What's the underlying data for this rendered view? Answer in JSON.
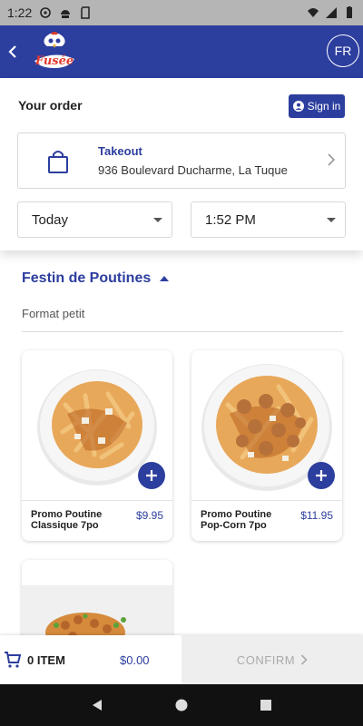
{
  "statusbar": {
    "time": "1:22"
  },
  "header": {
    "brand_logo_text": "Fusée",
    "lang_label": "FR"
  },
  "order": {
    "title": "Your order",
    "signin_label": "Sign in",
    "mode_label": "Takeout",
    "address": "936 Boulevard Ducharme, La Tuque",
    "day_value": "Today",
    "time_value": "1:52 PM"
  },
  "category": {
    "name": "Festin de Poutines",
    "subtitle": "Format petit"
  },
  "products": [
    {
      "name": "Promo Poutine Classique 7po",
      "price": "$9.95"
    },
    {
      "name": "Promo Poutine Pop-Corn 7po",
      "price": "$11.95"
    }
  ],
  "cart": {
    "count_label": "0 ITEM",
    "total": "$0.00",
    "confirm_label": "CONFIRM"
  },
  "colors": {
    "brand": "#2c3e9e",
    "status_bar": "#b5b5b5",
    "nav_bar": "#111111"
  }
}
